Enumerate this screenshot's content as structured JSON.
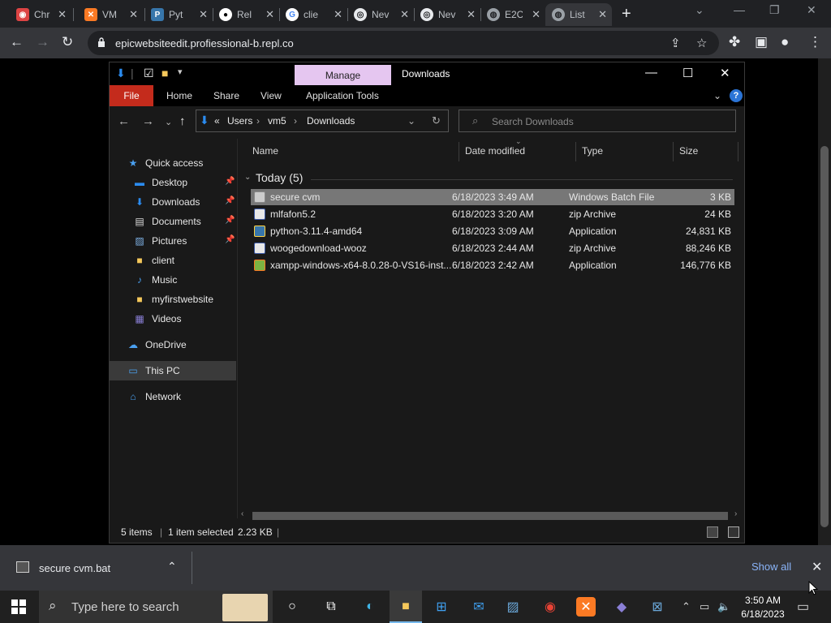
{
  "browser": {
    "tabs": [
      {
        "title": "Chr",
        "icon": "chrome-icon",
        "color": "#4285f4"
      },
      {
        "title": "VM",
        "icon": "xampp-icon",
        "color": "#fb7a24"
      },
      {
        "title": "Pyt",
        "icon": "python-icon",
        "color": "#3776ab"
      },
      {
        "title": "Rel",
        "icon": "github-icon",
        "color": "#ffffff"
      },
      {
        "title": "clie",
        "icon": "google-icon",
        "color": "#ffffff"
      },
      {
        "title": "Nev",
        "icon": "chrome-icon",
        "color": "#e8eaed"
      },
      {
        "title": "Nev",
        "icon": "chrome-icon",
        "color": "#e8eaed"
      },
      {
        "title": "E2C",
        "icon": "globe-icon",
        "color": "#9aa0a6"
      },
      {
        "title": "List",
        "icon": "globe-icon",
        "color": "#9aa0a6"
      }
    ],
    "url": "epicwebsiteedit.profiessional-b.repl.co"
  },
  "explorer": {
    "title": "Downloads",
    "manage_label": "Manage",
    "ribbon_tabs": [
      "File",
      "Home",
      "Share",
      "View",
      "Application Tools"
    ],
    "breadcrumb": {
      "prefix": "«",
      "parts": [
        "Users",
        "vm5",
        "Downloads"
      ]
    },
    "search_placeholder": "Search Downloads",
    "nav": {
      "quick_access": "Quick access",
      "items": [
        {
          "label": "Desktop",
          "icon": "desktop-icon",
          "pinned": true
        },
        {
          "label": "Downloads",
          "icon": "downloads-icon",
          "pinned": true
        },
        {
          "label": "Documents",
          "icon": "documents-icon",
          "pinned": true
        },
        {
          "label": "Pictures",
          "icon": "pictures-icon",
          "pinned": true
        },
        {
          "label": "client",
          "icon": "folder-icon",
          "pinned": false
        },
        {
          "label": "Music",
          "icon": "music-icon",
          "pinned": false
        },
        {
          "label": "myfirstwebsite",
          "icon": "folder-icon",
          "pinned": false
        },
        {
          "label": "Videos",
          "icon": "videos-icon",
          "pinned": false
        }
      ],
      "onedrive": "OneDrive",
      "this_pc": "This PC",
      "network": "Network"
    },
    "columns": [
      "Name",
      "Date modified",
      "Type",
      "Size"
    ],
    "group": "Today (5)",
    "files": [
      {
        "name": "secure cvm",
        "date": "6/18/2023 3:49 AM",
        "type": "Windows Batch File",
        "size": "3 KB",
        "selected": true
      },
      {
        "name": "mlfafon5.2",
        "date": "6/18/2023 3:20 AM",
        "type": "zip Archive",
        "size": "24 KB",
        "selected": false
      },
      {
        "name": "python-3.11.4-amd64",
        "date": "6/18/2023 3:09 AM",
        "type": "Application",
        "size": "24,831 KB",
        "selected": false
      },
      {
        "name": "woogedownload-wooz",
        "date": "6/18/2023 2:44 AM",
        "type": "zip Archive",
        "size": "88,246 KB",
        "selected": false
      },
      {
        "name": "xampp-windows-x64-8.0.28-0-VS16-inst...",
        "date": "6/18/2023 2:42 AM",
        "type": "Application",
        "size": "146,776 KB",
        "selected": false
      }
    ],
    "status": {
      "items": "5 items",
      "selected": "1 item selected",
      "size": "2.23 KB"
    }
  },
  "download_shelf": {
    "filename": "secure cvm.bat",
    "show_all": "Show all"
  },
  "taskbar": {
    "search_placeholder": "Type here to search",
    "time": "3:50 AM",
    "date": "6/18/2023"
  }
}
